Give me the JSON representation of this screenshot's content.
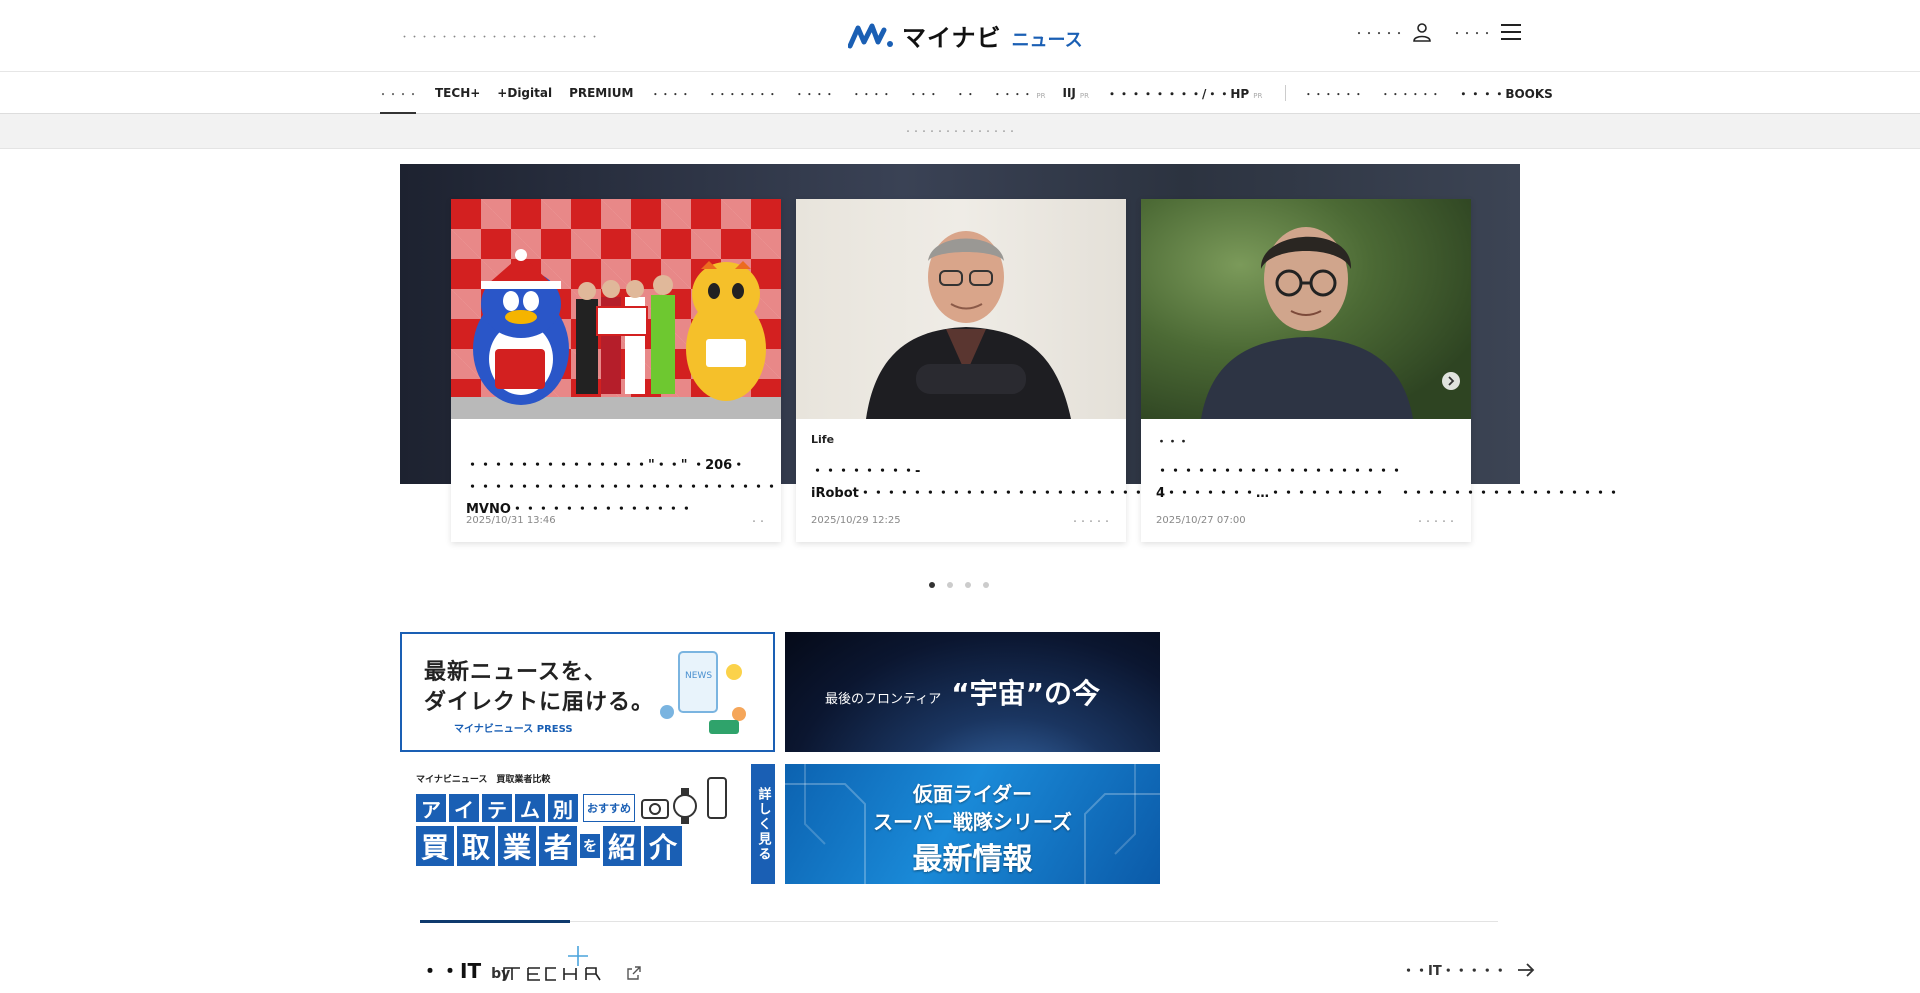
{
  "header": {
    "tagline": "・・・・・・・・・・・・・・・・・・・・",
    "logo_main": "マイナビ",
    "logo_sub": "ニュース",
    "account_label": "・・・・・",
    "menu_label": "・・・・"
  },
  "nav": {
    "items": [
      {
        "label": "・・・・",
        "style": "active",
        "pr": ""
      },
      {
        "label": "TECH+",
        "style": "bold",
        "pr": ""
      },
      {
        "label": "+Digital",
        "style": "bold",
        "pr": ""
      },
      {
        "label": "PREMIUM",
        "style": "bold",
        "pr": ""
      },
      {
        "label": "・・・・",
        "style": "small",
        "pr": ""
      },
      {
        "label": "・・・・・・・",
        "style": "small",
        "pr": ""
      },
      {
        "label": "・・・・",
        "style": "small",
        "pr": ""
      },
      {
        "label": "・・・・",
        "style": "small",
        "pr": ""
      },
      {
        "label": "・・・",
        "style": "small",
        "pr": ""
      },
      {
        "label": "・・",
        "style": "small",
        "pr": ""
      },
      {
        "label": "・・・・",
        "style": "small",
        "pr": "PR"
      },
      {
        "label": "IIJ",
        "style": "bold",
        "pr": "PR"
      },
      {
        "label": "・・・・・・・・/・・HP",
        "style": "bold",
        "pr": "PR"
      }
    ],
    "right_items": [
      {
        "label": "・・・・・・"
      },
      {
        "label": "・・・・・・"
      },
      {
        "label": "・・・・BOOKS"
      }
    ]
  },
  "notice": {
    "text": "・・・・・・・・・・・・・・"
  },
  "hero": {
    "cards": [
      {
        "category": "",
        "title": "・・・・・・・・・・・・・・\"・・\" ・206・ ・・・・・・・・・・・・・・・・・・・・・・・・MVNO・・・・・・・・・・・・・・",
        "date": "2025/10/31 13:46",
        "source": "・・"
      },
      {
        "category": "Life",
        "title": "・・・・・・・・- iRobot・・・・・・・・・・・・・・・・・・・・・・・・“・・・・”・・・・・",
        "date": "2025/10/29 12:25",
        "source": "・・・・・"
      },
      {
        "category": "・・・",
        "title": "・・・・・・・・・・・・・・・・・・・4・・・・・・・…・・・・・・・・・　・・・・・・・・・・・・・・・・・",
        "date": "2025/10/27 07:00",
        "source": "・・・・・"
      }
    ],
    "dots_active": 0,
    "dots_count": 4
  },
  "banners": {
    "press": {
      "line1": "最新ニュースを、",
      "line2": "ダイレクトに届ける。",
      "footer": "マイナビニュース PRESS"
    },
    "space": {
      "prefix": "最後のフロンティア",
      "big": "“宇宙”の今"
    },
    "kaitori": {
      "top": "マイナビニュース　買取業者比較",
      "row1": [
        "ア",
        "イ",
        "テ",
        "ム",
        "別"
      ],
      "row1_tag": "おすすめ",
      "row2": [
        "買",
        "取",
        "業",
        "者",
        "を",
        "紹",
        "介"
      ],
      "side": "詳しく見る"
    },
    "rider": {
      "line1": "仮面ライダー",
      "line2": "スーパー戦隊シリーズ",
      "line3": "最新情報"
    }
  },
  "section": {
    "title": "・・IT",
    "by": "by",
    "more": "・・IT・・・・・"
  },
  "colors": {
    "brand_blue": "#1a5fb4",
    "section_accent": "#0f3a6e"
  }
}
